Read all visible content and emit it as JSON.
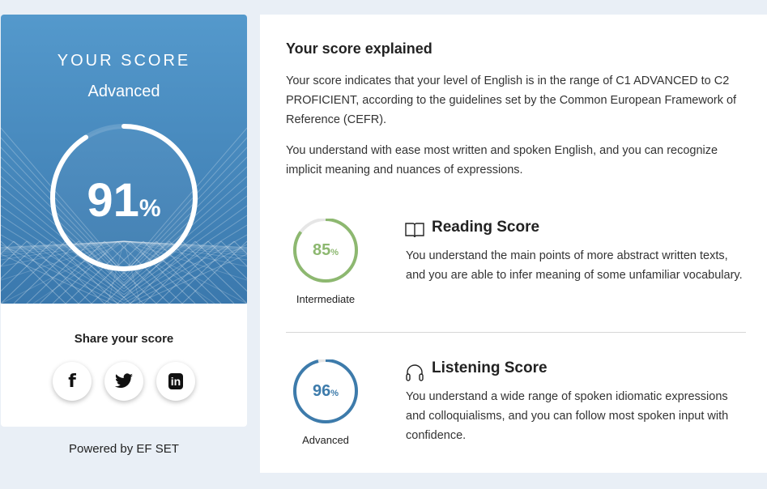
{
  "score_card": {
    "heading": "YOUR SCORE",
    "level": "Advanced",
    "score": 91,
    "score_number": "91",
    "percent_sign": "%",
    "share_label": "Share your score",
    "social": [
      {
        "name": "facebook",
        "glyph": "f"
      },
      {
        "name": "twitter",
        "glyph": "🐦"
      },
      {
        "name": "linkedin",
        "glyph": "in"
      }
    ],
    "powered_by": "Powered by EF SET"
  },
  "explained": {
    "title": "Your score explained",
    "para1": "Your score indicates that your level of English is in the range of C1 ADVANCED to C2 PROFICIENT, according to the guidelines set by the Common European Framework of Reference (CEFR).",
    "para2": "You understand with ease most written and spoken English, and you can recognize implicit meaning and nuances of expressions."
  },
  "sections": [
    {
      "title": "Reading Score",
      "icon": "book-icon",
      "score": 85,
      "score_text": "85",
      "percent_sign": "%",
      "level": "Intermediate",
      "color": "#8db870",
      "description": "You understand the main points of more abstract written texts, and you are able to infer meaning of some unfamiliar vocabulary."
    },
    {
      "title": "Listening Score",
      "icon": "headphones-icon",
      "score": 96,
      "score_text": "96",
      "percent_sign": "%",
      "level": "Advanced",
      "color": "#3d7bab",
      "description": "You understand a wide range of spoken idiomatic expressions and colloquialisms, and you can follow most spoken input with confidence."
    }
  ]
}
